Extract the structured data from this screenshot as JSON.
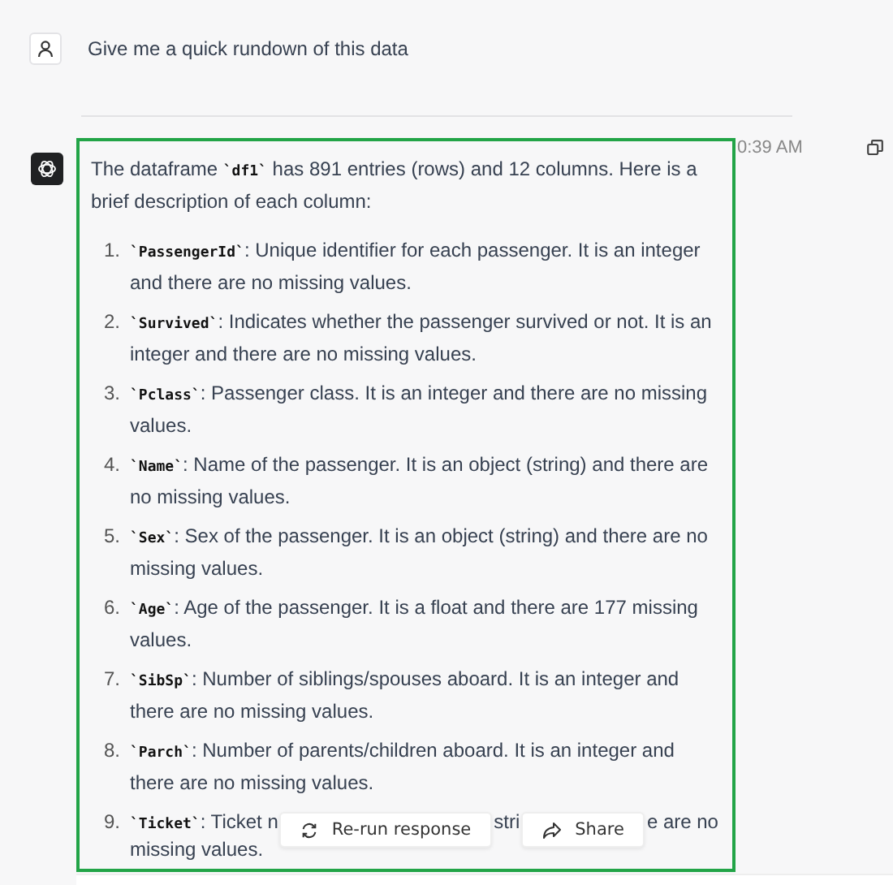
{
  "user_message": {
    "text": "Give me a quick rundown of this data"
  },
  "assistant_message": {
    "timestamp": "0:39 AM",
    "intro_before": "The dataframe ",
    "intro_code": "`df1`",
    "intro_after": " has 891 entries (rows) and 12 columns. Here is a brief description of each column:",
    "items": [
      {
        "number": "1.",
        "code": "`PassengerId`",
        "text": ": Unique identifier for each passenger. It is an integer and there are no missing values."
      },
      {
        "number": "2.",
        "code": "`Survived`",
        "text": ": Indicates whether the passenger survived or not. It is an integer and there are no missing values."
      },
      {
        "number": "3.",
        "code": "`Pclass`",
        "text": ": Passenger class. It is an integer and there are no missing values."
      },
      {
        "number": "4.",
        "code": "`Name`",
        "text": ": Name of the passenger. It is an object (string) and there are no missing values."
      },
      {
        "number": "5.",
        "code": "`Sex`",
        "text": ": Sex of the passenger. It is an object (string) and there are no missing values."
      },
      {
        "number": "6.",
        "code": "`Age`",
        "text": ": Age of the passenger. It is a float and there are 177 missing values."
      },
      {
        "number": "7.",
        "code": "`SibSp`",
        "text": ": Number of siblings/spouses aboard. It is an integer and there are no missing values."
      },
      {
        "number": "8.",
        "code": "`Parch`",
        "text": ": Number of parents/children aboard. It is an integer and there are no missing values."
      },
      {
        "number": "9.",
        "code": "`Ticket`",
        "visible_parts": [
          ": Ticket n",
          "stri",
          "e are no"
        ],
        "second_line": "missing values."
      }
    ]
  },
  "actions": [
    {
      "kind": "rerun",
      "label": "Re-run response"
    },
    {
      "kind": "share",
      "label": "Share"
    }
  ]
}
